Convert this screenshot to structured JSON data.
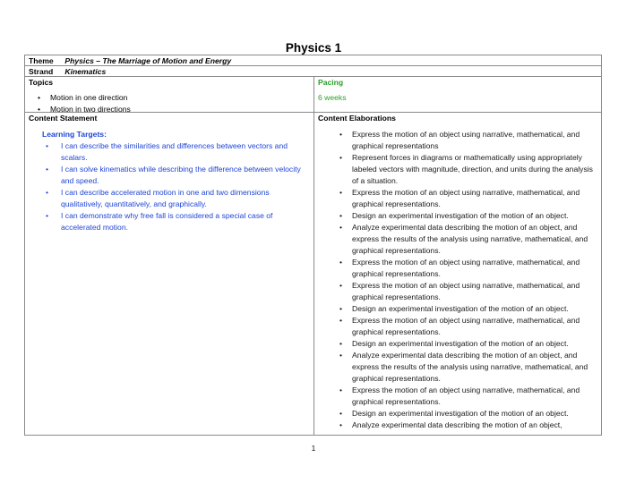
{
  "document": {
    "title": "Physics 1",
    "page_number": "1"
  },
  "header_rows": [
    {
      "label": "Theme",
      "value": "Physics – The Marriage of Motion and Energy"
    },
    {
      "label": "Strand",
      "value": "Kinematics"
    }
  ],
  "topics": {
    "heading": "Topics",
    "items": [
      "Motion in one direction",
      "Motion in two directions"
    ]
  },
  "pacing": {
    "heading": "Pacing",
    "value": "6 weeks",
    "color": "#2ca02c"
  },
  "content_statement": {
    "heading": "Content Statement",
    "learning_targets_title": "Learning Targets:",
    "color": "#1f45d6",
    "items": [
      "I can describe the similarities and differences between vectors and scalars.",
      "I can solve kinematics while describing the difference between velocity and speed.",
      "I can describe accelerated motion in one and two dimensions qualitatively, quantitatively, and graphically.",
      "I can demonstrate why free fall is considered a special case of accelerated motion."
    ]
  },
  "content_elaborations": {
    "heading": "Content Elaborations",
    "items": [
      "Express the motion of an object using narrative, mathematical, and graphical representations",
      "Represent forces in diagrams or mathematically using appropriately labeled vectors with magnitude, direction, and units during the analysis of a situation.",
      "Express the motion of an object using narrative, mathematical, and graphical representations.",
      "Design an experimental investigation of the motion of an object.",
      "Analyze experimental data describing the motion of an object, and express the results of the analysis using narrative, mathematical, and graphical representations.",
      "Express the motion of an object using narrative, mathematical, and graphical representations.",
      "Express the motion of an object using narrative, mathematical, and graphical representations.",
      "Design an experimental investigation of the motion of an object.",
      "Express the motion of an object using narrative, mathematical, and graphical representations.",
      "Design an experimental investigation of the motion of an object.",
      "Analyze experimental data describing the motion of an object, and express the results of the analysis using narrative, mathematical, and graphical representations.",
      "Express the motion of an object using narrative, mathematical, and graphical representations.",
      "Design an experimental investigation of the motion of an object.",
      "Analyze experimental data describing the motion of an object,"
    ]
  }
}
